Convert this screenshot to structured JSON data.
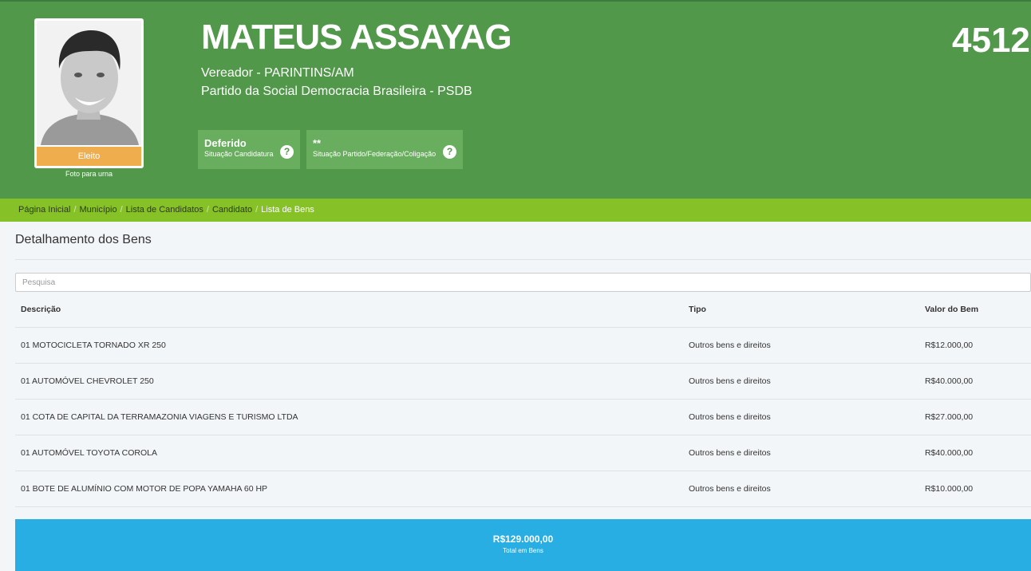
{
  "candidate": {
    "name": "MATEUS ASSAYAG",
    "number": "4512",
    "role": "Vereador - PARINTINS/AM",
    "party": "Partido da Social Democracia Brasileira - PSDB",
    "photo_badge": "Eleito",
    "photo_caption": "Foto para urna"
  },
  "status": [
    {
      "value": "Deferido",
      "label": "Situação Candidatura",
      "icon": "question-circle-icon"
    },
    {
      "value": "**",
      "label": "Situação Partido/Federação/Coligação",
      "icon": "question-circle-icon"
    }
  ],
  "breadcrumb": [
    "Página Inicial",
    "Município",
    "Lista de Candidatos",
    "Candidato",
    "Lista de Bens"
  ],
  "panel": {
    "title": "Detalhamento dos Bens",
    "search_placeholder": "Pesquisa"
  },
  "table": {
    "headers": [
      "Descrição",
      "Tipo",
      "Valor do Bem"
    ],
    "rows": [
      [
        "01 MOTOCICLETA TORNADO XR 250",
        "Outros bens e direitos",
        "R$12.000,00"
      ],
      [
        "01 AUTOMÓVEL CHEVROLET 250",
        "Outros bens e direitos",
        "R$40.000,00"
      ],
      [
        "01 COTA DE CAPITAL DA TERRAMAZONIA VIAGENS E TURISMO LTDA",
        "Outros bens e direitos",
        "R$27.000,00"
      ],
      [
        "01 AUTOMÓVEL TOYOTA COROLA",
        "Outros bens e direitos",
        "R$40.000,00"
      ],
      [
        "01 BOTE DE ALUMÍNIO COM MOTOR DE POPA YAMAHA 60 HP",
        "Outros bens e direitos",
        "R$10.000,00"
      ]
    ]
  },
  "total": {
    "amount": "R$129.000,00",
    "label": "Total em Bens"
  },
  "colors": {
    "header_green": "#51984a",
    "breadcrumb_green": "#86c227",
    "elected_orange": "#f0ad4e",
    "total_blue": "#29aee4"
  }
}
